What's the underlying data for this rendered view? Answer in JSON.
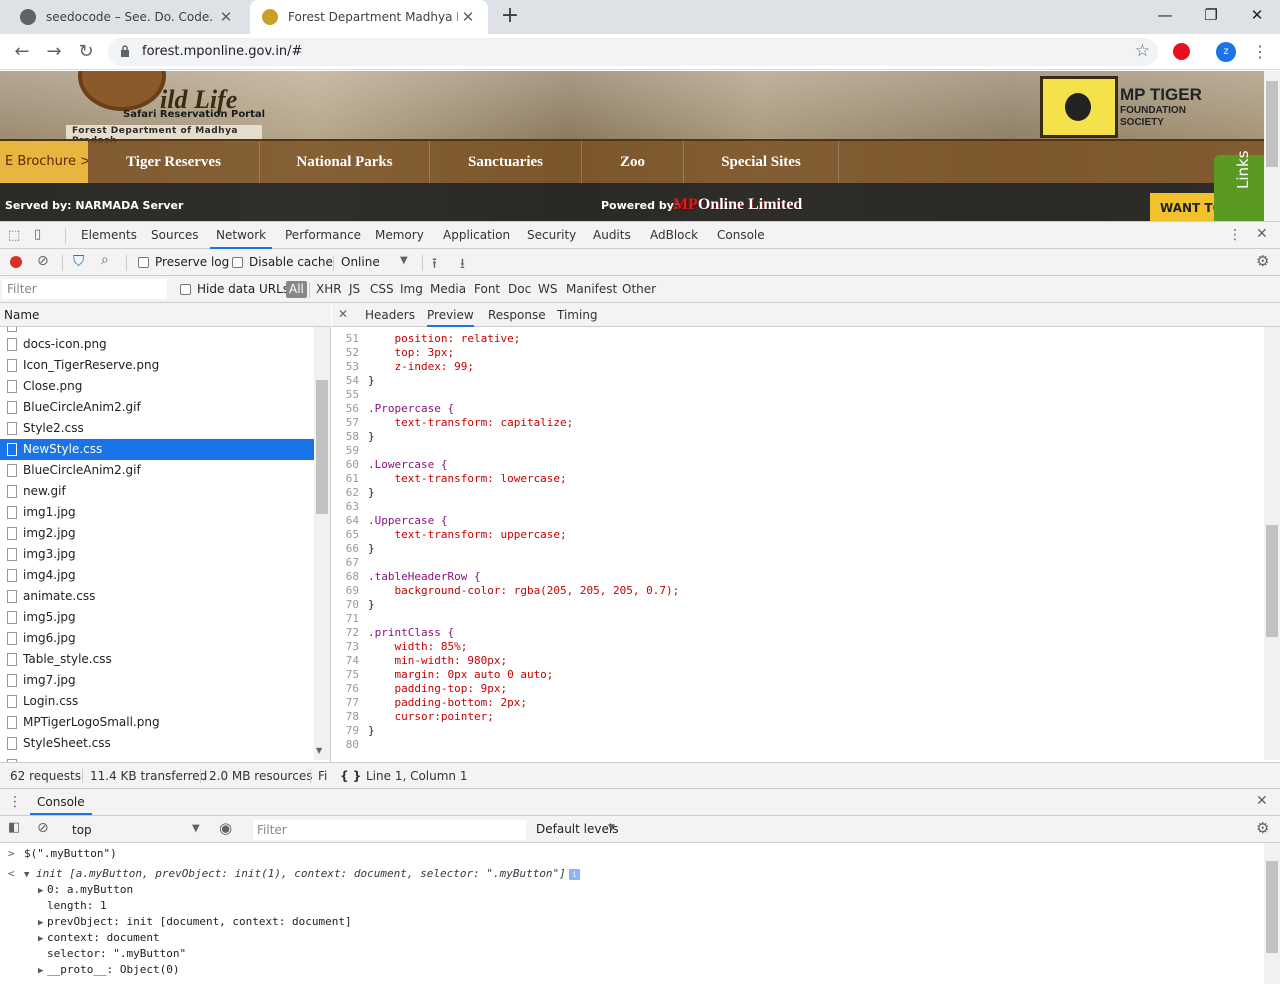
{
  "browser": {
    "tabs": [
      {
        "title": "seedocode – See. Do. Code.",
        "active": false
      },
      {
        "title": "Forest Department Madhya Prad",
        "active": true
      }
    ],
    "url": "forest.mponline.gov.in/#",
    "profile_initial": "z"
  },
  "site": {
    "logo_text": "ild Life",
    "logo_sub": "Safari Reservation Portal",
    "logo_dept": "Forest Department of Madhya Pradesh",
    "tiger_logo": [
      "MP TIGER",
      "FOUNDATION",
      "SOCIETY"
    ],
    "brochure": "E Brochure >",
    "nav": [
      "Tiger Reserves",
      "National Parks",
      "Sanctuaries",
      "Zoo",
      "Special Sites"
    ],
    "served_by": "Served by: NARMADA Server",
    "powered_by": "Powered by:",
    "mponline_mp": "MP",
    "mponline_rest": "Online Limited",
    "want_to": "WANT TO",
    "links": "Links"
  },
  "devtools": {
    "tabs": [
      "Elements",
      "Sources",
      "Network",
      "Performance",
      "Memory",
      "Application",
      "Security",
      "Audits",
      "AdBlock",
      "Console"
    ],
    "active_tab": "Network",
    "network_toolbar": {
      "preserve_log": "Preserve log",
      "disable_cache": "Disable cache",
      "throttle": "Online"
    },
    "filter": {
      "placeholder": "Filter",
      "hide_data_urls": "Hide data URLs",
      "types": [
        "All",
        "XHR",
        "JS",
        "CSS",
        "Img",
        "Media",
        "Font",
        "Doc",
        "WS",
        "Manifest",
        "Other"
      ]
    },
    "request_list": {
      "column": "Name",
      "items": [
        "docs-icon.png",
        "Icon_TigerReserve.png",
        "Close.png",
        "BlueCircleAnim2.gif",
        "Style2.css",
        "NewStyle.css",
        "BlueCircleAnim2.gif",
        "new.gif",
        "img1.jpg",
        "img2.jpg",
        "img3.jpg",
        "img4.jpg",
        "animate.css",
        "img5.jpg",
        "img6.jpg",
        "Table_style.css",
        "img7.jpg",
        "Login.css",
        "MPTigerLogoSmall.png",
        "StyleSheet.css"
      ],
      "selected": "NewStyle.css"
    },
    "detail_tabs": [
      "Headers",
      "Preview",
      "Response",
      "Timing"
    ],
    "code_lines": [
      {
        "n": "51",
        "t": "    position: relative;"
      },
      {
        "n": "52",
        "t": "    top: 3px;"
      },
      {
        "n": "53",
        "t": "    z-index: 99;"
      },
      {
        "n": "54",
        "t": "}"
      },
      {
        "n": "55",
        "t": ""
      },
      {
        "n": "56",
        "t": ".Propercase {"
      },
      {
        "n": "57",
        "t": "    text-transform: capitalize;"
      },
      {
        "n": "58",
        "t": "}"
      },
      {
        "n": "59",
        "t": ""
      },
      {
        "n": "60",
        "t": ".Lowercase {"
      },
      {
        "n": "61",
        "t": "    text-transform: lowercase;"
      },
      {
        "n": "62",
        "t": "}"
      },
      {
        "n": "63",
        "t": ""
      },
      {
        "n": "64",
        "t": ".Uppercase {"
      },
      {
        "n": "65",
        "t": "    text-transform: uppercase;"
      },
      {
        "n": "66",
        "t": "}"
      },
      {
        "n": "67",
        "t": ""
      },
      {
        "n": "68",
        "t": ".tableHeaderRow {"
      },
      {
        "n": "69",
        "t": "    background-color: rgba(205, 205, 205, 0.7);"
      },
      {
        "n": "70",
        "t": "}"
      },
      {
        "n": "71",
        "t": ""
      },
      {
        "n": "72",
        "t": ".printClass {"
      },
      {
        "n": "73",
        "t": "    width: 85%;"
      },
      {
        "n": "74",
        "t": "    min-width: 980px;"
      },
      {
        "n": "75",
        "t": "    margin: 0px auto 0 auto;"
      },
      {
        "n": "76",
        "t": "    padding-top: 9px;"
      },
      {
        "n": "77",
        "t": "    padding-bottom: 2px;"
      },
      {
        "n": "78",
        "t": "    cursor:pointer;"
      },
      {
        "n": "79",
        "t": "}"
      },
      {
        "n": "80",
        "t": ""
      }
    ],
    "status": {
      "requests": "62 requests",
      "transferred": "11.4 KB transferred",
      "resources": "2.0 MB resources",
      "cut": "Fi",
      "position": "Line 1, Column 1"
    },
    "console": {
      "title": "Console",
      "context": "top",
      "filter_placeholder": "Filter",
      "levels": "Default levels",
      "lines": [
        {
          "kind": "input",
          "text": "$(\".myButton\")"
        },
        {
          "kind": "output",
          "text": "init [a.myButton, prevObject: init(1), context: document, selector: \".myButton\"]"
        },
        {
          "kind": "prop",
          "text": "0: a.myButton"
        },
        {
          "kind": "prop",
          "text": "length: 1"
        },
        {
          "kind": "prop",
          "text": "prevObject: init [document, context: document]"
        },
        {
          "kind": "prop",
          "text": "context: document"
        },
        {
          "kind": "prop",
          "text": "selector: \".myButton\""
        },
        {
          "kind": "prop",
          "text": "__proto__: Object(0)"
        }
      ]
    }
  },
  "colors": {
    "accent": "#1a73e8",
    "record": "#d93025",
    "brochure": "#e8b53e",
    "links_tab": "#5a9a22"
  }
}
